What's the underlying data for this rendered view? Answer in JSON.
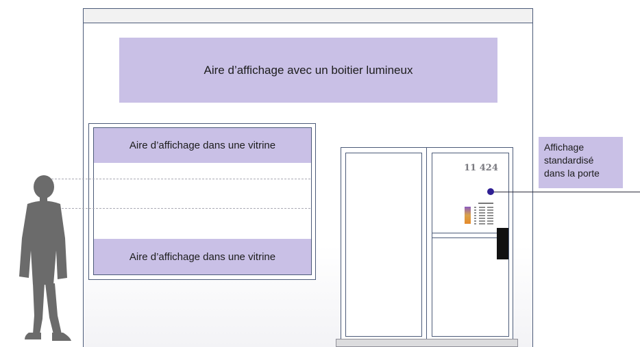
{
  "lightbox": {
    "label": "Aire d’affichage avec un boitier lumineux"
  },
  "vitrine": {
    "top_label": "Aire d’affichage dans une vitrine",
    "bottom_label": "Aire d’affichage dans une vitrine"
  },
  "door": {
    "street_number": "11 424"
  },
  "callout": {
    "lines": [
      "Affichage",
      "standardisé",
      "dans la porte"
    ]
  },
  "colors": {
    "display_area": "#c9c0e6",
    "outline": "#4b5a78",
    "marker_dot": "#2f1f93",
    "silhouette": "#6b6b6b",
    "handle": "#111111"
  }
}
